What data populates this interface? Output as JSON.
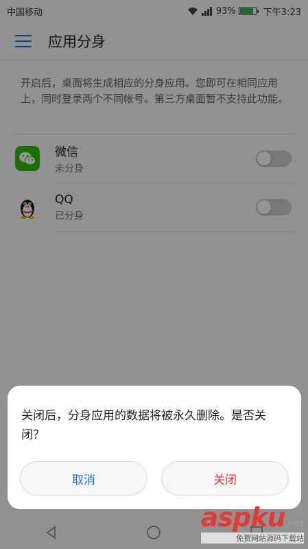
{
  "status_bar": {
    "carrier": "中国移动",
    "battery_percent": "93%",
    "battery_level": 0.93,
    "time": "下午3:23",
    "icons": [
      "wifi-icon",
      "signal-icon",
      "battery-icon"
    ]
  },
  "app_bar": {
    "title": "应用分身",
    "menu_icon": "hamburger-menu-icon"
  },
  "description": "开启后，桌面将生成相应的分身应用。您即可在相同应用上，同时登录两个不同帐号。第三方桌面暂不支持此功能。",
  "apps": [
    {
      "name": "微信",
      "status": "未分身",
      "enabled": false,
      "icon": "wechat-icon"
    },
    {
      "name": "QQ",
      "status": "已分身",
      "enabled": false,
      "icon": "qq-penguin-icon"
    }
  ],
  "dialog": {
    "message": "关闭后，分身应用的数据将被永久删除。是否关闭？",
    "cancel_label": "取消",
    "confirm_label": "关闭",
    "colors": {
      "cancel": "#1e73d8",
      "confirm": "#e53935"
    }
  },
  "nav_bar": {
    "icons": [
      "back-triangle-icon",
      "home-circle-icon",
      "recents-square-icon"
    ]
  },
  "watermark": {
    "logo": "aspku",
    "domain_suffix": ".net",
    "subtext": "免费网站源码下载站"
  }
}
